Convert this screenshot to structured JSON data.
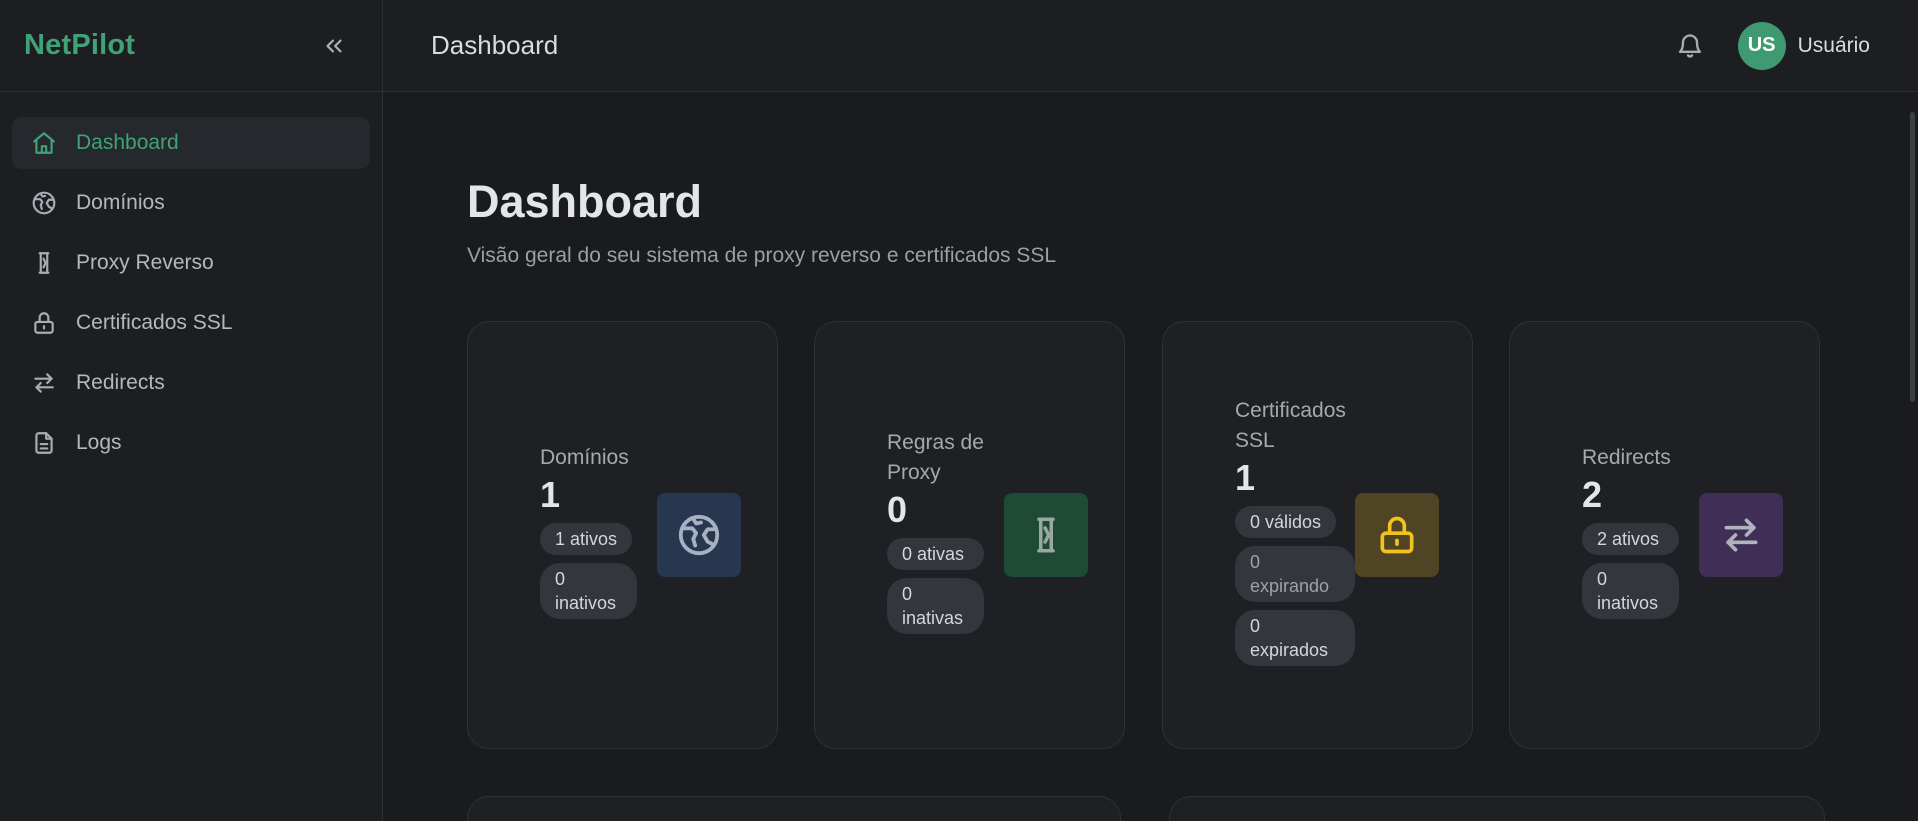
{
  "brand": "NetPilot",
  "sidebar": {
    "items": [
      {
        "label": "Dashboard",
        "icon": "home-icon",
        "active": true
      },
      {
        "label": "Domínios",
        "icon": "globe-icon"
      },
      {
        "label": "Proxy Reverso",
        "icon": "proxy-icon"
      },
      {
        "label": "Certificados SSL",
        "icon": "lock-icon"
      },
      {
        "label": "Redirects",
        "icon": "arrows-icon"
      },
      {
        "label": "Logs",
        "icon": "file-icon"
      }
    ]
  },
  "header": {
    "title": "Dashboard",
    "user": {
      "initials": "US",
      "name": "Usuário"
    }
  },
  "main": {
    "title": "Dashboard",
    "subtitle": "Visão geral do seu sistema de proxy reverso e certificados SSL"
  },
  "cards": [
    {
      "label": "Domínios",
      "value": "1",
      "badges": [
        "1 ativos",
        "0 inativos"
      ],
      "icon": "globe-icon",
      "icon_bg": "#27374f",
      "icon_color": "#a7b1c2"
    },
    {
      "label": "Regras de Proxy",
      "value": "0",
      "badges": [
        "0 ativas",
        "0 inativas"
      ],
      "icon": "proxy-icon",
      "icon_bg": "#1f4a36",
      "icon_color": "#9aa9a0"
    },
    {
      "label": "Certificados SSL",
      "value": "1",
      "badges": [
        "0 válidos",
        "0 expirando",
        "0 expirados"
      ],
      "icon": "lock-icon",
      "icon_bg": "#4f4423",
      "icon_color": "#f2c31c"
    },
    {
      "label": "Redirects",
      "value": "2",
      "badges": [
        "2 ativos",
        "0 inativos"
      ],
      "icon": "arrows-icon",
      "icon_bg": "#3f2f57",
      "icon_color": "#b0b3bb"
    }
  ],
  "colors": {
    "accent": "#40a277",
    "background": "#1a1b1e",
    "sidebar": "#1c1e22"
  }
}
